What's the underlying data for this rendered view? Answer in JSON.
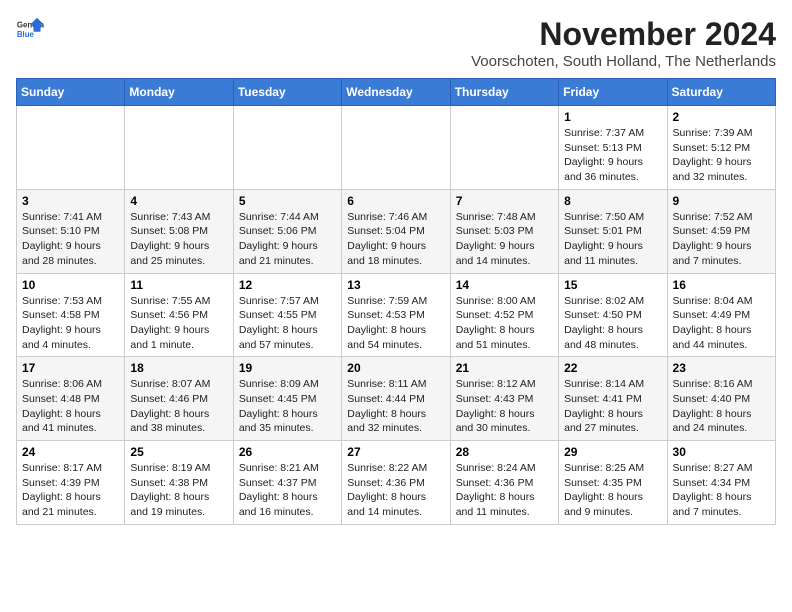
{
  "header": {
    "logo_line1": "General",
    "logo_line2": "Blue",
    "title": "November 2024",
    "location": "Voorschoten, South Holland, The Netherlands"
  },
  "calendar": {
    "days_of_week": [
      "Sunday",
      "Monday",
      "Tuesday",
      "Wednesday",
      "Thursday",
      "Friday",
      "Saturday"
    ],
    "weeks": [
      [
        {
          "day": "",
          "info": ""
        },
        {
          "day": "",
          "info": ""
        },
        {
          "day": "",
          "info": ""
        },
        {
          "day": "",
          "info": ""
        },
        {
          "day": "",
          "info": ""
        },
        {
          "day": "1",
          "info": "Sunrise: 7:37 AM\nSunset: 5:13 PM\nDaylight: 9 hours and 36 minutes."
        },
        {
          "day": "2",
          "info": "Sunrise: 7:39 AM\nSunset: 5:12 PM\nDaylight: 9 hours and 32 minutes."
        }
      ],
      [
        {
          "day": "3",
          "info": "Sunrise: 7:41 AM\nSunset: 5:10 PM\nDaylight: 9 hours and 28 minutes."
        },
        {
          "day": "4",
          "info": "Sunrise: 7:43 AM\nSunset: 5:08 PM\nDaylight: 9 hours and 25 minutes."
        },
        {
          "day": "5",
          "info": "Sunrise: 7:44 AM\nSunset: 5:06 PM\nDaylight: 9 hours and 21 minutes."
        },
        {
          "day": "6",
          "info": "Sunrise: 7:46 AM\nSunset: 5:04 PM\nDaylight: 9 hours and 18 minutes."
        },
        {
          "day": "7",
          "info": "Sunrise: 7:48 AM\nSunset: 5:03 PM\nDaylight: 9 hours and 14 minutes."
        },
        {
          "day": "8",
          "info": "Sunrise: 7:50 AM\nSunset: 5:01 PM\nDaylight: 9 hours and 11 minutes."
        },
        {
          "day": "9",
          "info": "Sunrise: 7:52 AM\nSunset: 4:59 PM\nDaylight: 9 hours and 7 minutes."
        }
      ],
      [
        {
          "day": "10",
          "info": "Sunrise: 7:53 AM\nSunset: 4:58 PM\nDaylight: 9 hours and 4 minutes."
        },
        {
          "day": "11",
          "info": "Sunrise: 7:55 AM\nSunset: 4:56 PM\nDaylight: 9 hours and 1 minute."
        },
        {
          "day": "12",
          "info": "Sunrise: 7:57 AM\nSunset: 4:55 PM\nDaylight: 8 hours and 57 minutes."
        },
        {
          "day": "13",
          "info": "Sunrise: 7:59 AM\nSunset: 4:53 PM\nDaylight: 8 hours and 54 minutes."
        },
        {
          "day": "14",
          "info": "Sunrise: 8:00 AM\nSunset: 4:52 PM\nDaylight: 8 hours and 51 minutes."
        },
        {
          "day": "15",
          "info": "Sunrise: 8:02 AM\nSunset: 4:50 PM\nDaylight: 8 hours and 48 minutes."
        },
        {
          "day": "16",
          "info": "Sunrise: 8:04 AM\nSunset: 4:49 PM\nDaylight: 8 hours and 44 minutes."
        }
      ],
      [
        {
          "day": "17",
          "info": "Sunrise: 8:06 AM\nSunset: 4:48 PM\nDaylight: 8 hours and 41 minutes."
        },
        {
          "day": "18",
          "info": "Sunrise: 8:07 AM\nSunset: 4:46 PM\nDaylight: 8 hours and 38 minutes."
        },
        {
          "day": "19",
          "info": "Sunrise: 8:09 AM\nSunset: 4:45 PM\nDaylight: 8 hours and 35 minutes."
        },
        {
          "day": "20",
          "info": "Sunrise: 8:11 AM\nSunset: 4:44 PM\nDaylight: 8 hours and 32 minutes."
        },
        {
          "day": "21",
          "info": "Sunrise: 8:12 AM\nSunset: 4:43 PM\nDaylight: 8 hours and 30 minutes."
        },
        {
          "day": "22",
          "info": "Sunrise: 8:14 AM\nSunset: 4:41 PM\nDaylight: 8 hours and 27 minutes."
        },
        {
          "day": "23",
          "info": "Sunrise: 8:16 AM\nSunset: 4:40 PM\nDaylight: 8 hours and 24 minutes."
        }
      ],
      [
        {
          "day": "24",
          "info": "Sunrise: 8:17 AM\nSunset: 4:39 PM\nDaylight: 8 hours and 21 minutes."
        },
        {
          "day": "25",
          "info": "Sunrise: 8:19 AM\nSunset: 4:38 PM\nDaylight: 8 hours and 19 minutes."
        },
        {
          "day": "26",
          "info": "Sunrise: 8:21 AM\nSunset: 4:37 PM\nDaylight: 8 hours and 16 minutes."
        },
        {
          "day": "27",
          "info": "Sunrise: 8:22 AM\nSunset: 4:36 PM\nDaylight: 8 hours and 14 minutes."
        },
        {
          "day": "28",
          "info": "Sunrise: 8:24 AM\nSunset: 4:36 PM\nDaylight: 8 hours and 11 minutes."
        },
        {
          "day": "29",
          "info": "Sunrise: 8:25 AM\nSunset: 4:35 PM\nDaylight: 8 hours and 9 minutes."
        },
        {
          "day": "30",
          "info": "Sunrise: 8:27 AM\nSunset: 4:34 PM\nDaylight: 8 hours and 7 minutes."
        }
      ]
    ]
  }
}
